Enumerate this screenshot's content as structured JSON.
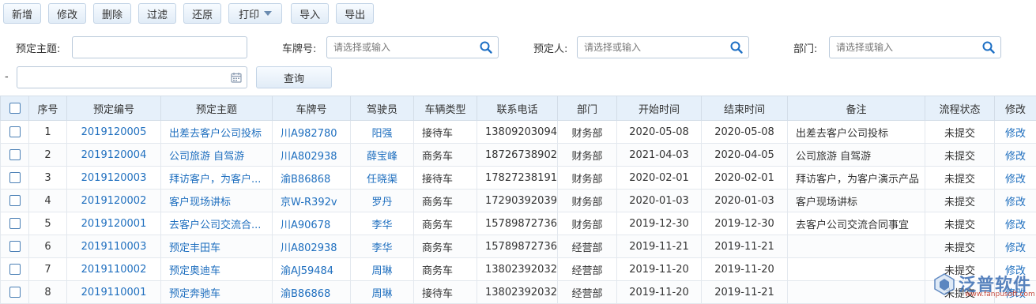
{
  "toolbar": {
    "add": "新增",
    "edit": "修改",
    "delete": "删除",
    "filter": "过滤",
    "restore": "还原",
    "print": "打印",
    "import": "导入",
    "export": "导出"
  },
  "search": {
    "subject_label": "预定主题:",
    "subject_value": "",
    "plate_label": "车牌号:",
    "plate_placeholder": "请选择或输入",
    "booker_label": "预定人:",
    "booker_placeholder": "请选择或输入",
    "dept_label": "部门:",
    "dept_placeholder": "请选择或输入",
    "dash": "-",
    "query": "查询"
  },
  "table": {
    "headers": [
      "序号",
      "预定编号",
      "预定主题",
      "车牌号",
      "驾驶员",
      "车辆类型",
      "联系电话",
      "部门",
      "开始时间",
      "结束时间",
      "备注",
      "流程状态",
      "修改"
    ],
    "rows": [
      {
        "no": "1",
        "code": "2019120005",
        "subject": "出差去客户公司投标",
        "plate": "川A982780",
        "driver": "阳强",
        "type": "接待车",
        "phone": "13809203094",
        "dept": "财务部",
        "start": "2020-05-08",
        "end": "2020-05-08",
        "note": "出差去客户公司投标",
        "status": "未提交",
        "action": "修改"
      },
      {
        "no": "2",
        "code": "2019120004",
        "subject": "公司旅游 自驾游",
        "plate": "川A802938",
        "driver": "薛宝峰",
        "type": "商务车",
        "phone": "18726738902",
        "dept": "财务部",
        "start": "2021-04-03",
        "end": "2020-04-05",
        "note": "公司旅游 自驾游",
        "status": "未提交",
        "action": "修改"
      },
      {
        "no": "3",
        "code": "2019120003",
        "subject": "拜访客户，为客户...",
        "plate": "渝B86868",
        "driver": "任晓渠",
        "type": "接待车",
        "phone": "17827238191",
        "dept": "财务部",
        "start": "2020-02-01",
        "end": "2020-02-01",
        "note": "拜访客户，为客户演示产品",
        "status": "未提交",
        "action": "修改"
      },
      {
        "no": "4",
        "code": "2019120002",
        "subject": "客户现场讲标",
        "plate": "京W-R392v",
        "driver": "罗丹",
        "type": "商务车",
        "phone": "17290392039",
        "dept": "财务部",
        "start": "2020-01-03",
        "end": "2020-01-03",
        "note": "客户现场讲标",
        "status": "未提交",
        "action": "修改"
      },
      {
        "no": "5",
        "code": "2019120001",
        "subject": "去客户公司交流合...",
        "plate": "川A90678",
        "driver": "李华",
        "type": "商务车",
        "phone": "15789872736",
        "dept": "财务部",
        "start": "2019-12-30",
        "end": "2019-12-30",
        "note": "去客户公司交流合同事宜",
        "status": "未提交",
        "action": "修改"
      },
      {
        "no": "6",
        "code": "2019110003",
        "subject": "预定丰田车",
        "plate": "川A802938",
        "driver": "李华",
        "type": "商务车",
        "phone": "15789872736",
        "dept": "经营部",
        "start": "2019-11-21",
        "end": "2019-11-21",
        "note": "",
        "status": "未提交",
        "action": "修改"
      },
      {
        "no": "7",
        "code": "2019110002",
        "subject": "预定奥迪车",
        "plate": "渝AJ59484",
        "driver": "周琳",
        "type": "商务车",
        "phone": "13802392032",
        "dept": "经营部",
        "start": "2019-11-20",
        "end": "2019-11-20",
        "note": "",
        "status": "未提交",
        "action": "修改"
      },
      {
        "no": "8",
        "code": "2019110001",
        "subject": "预定奔驰车",
        "plate": "渝B86868",
        "driver": "周琳",
        "type": "接待车",
        "phone": "13802392032",
        "dept": "经营部",
        "start": "2019-11-20",
        "end": "2019-11-21",
        "note": "",
        "status": "未提交",
        "action": "修改"
      }
    ]
  },
  "watermark": {
    "brand": "泛普软件",
    "url": "www.fanpusoft.com"
  },
  "colors": {
    "link": "#1f6fbf",
    "header_bg": "#e6f0fa",
    "button_border": "#c3d4e6"
  }
}
